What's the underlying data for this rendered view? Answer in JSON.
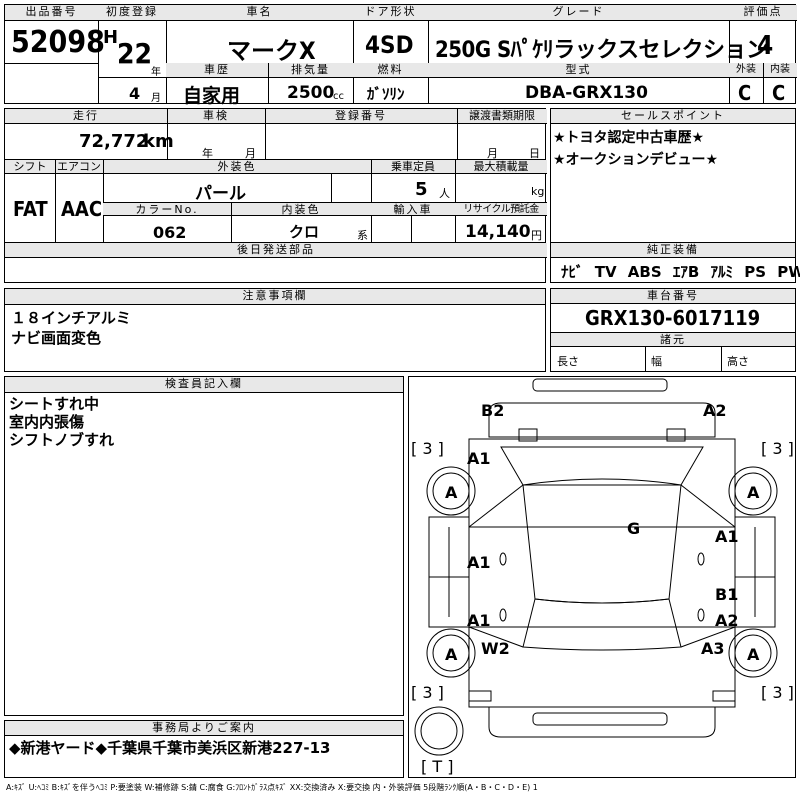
{
  "top": {
    "lot_label": "出品番号",
    "lot_number": "52098",
    "first_reg_label": "初度登録",
    "era": "H",
    "year": "22",
    "year_unit": "年",
    "month": "4",
    "month_unit": "月",
    "model_label": "車名",
    "model": "マークX",
    "door_label": "ドア形状",
    "door": "4SD",
    "grade_label": "グレード",
    "grade": "250G Sﾊﾟｹﾘラックスセレクション",
    "score_label": "評価点",
    "score": "4",
    "history_label": "車歴",
    "history": "自家用",
    "displacement_label": "排気量",
    "displacement": "2500",
    "cc": "cc",
    "fuel_label": "燃料",
    "fuel": "ｶﾞｿﾘﾝ",
    "type_label": "型式",
    "type": "DBA-GRX130",
    "ext_label": "外装",
    "ext": "C",
    "int_label": "内装",
    "int": "C"
  },
  "mid": {
    "mileage_label": "走行",
    "mileage": "72,772",
    "km": "km",
    "inspection_label": "車検",
    "insp_year": "年",
    "insp_month": "月",
    "reg_label": "登録番号",
    "doc_label": "譲渡書類期限",
    "doc_month": "月",
    "doc_day": "日",
    "shift_label": "シフト",
    "shift": "FAT",
    "ac_label": "エアコン",
    "ac": "AAC",
    "exterior_color_label": "外装色",
    "exterior_color": "パール",
    "capacity_label": "乗車定員",
    "capacity": "5",
    "capacity_unit": "人",
    "load_label": "最大積載量",
    "load_unit": "kg",
    "color_no_label": "カラーNo.",
    "color_no": "062",
    "interior_color_label": "内装色",
    "interior_color": "クロ",
    "interior_suffix": "系",
    "import_label": "輸入車",
    "recycle_label": "リサイクル預託金",
    "recycle": "14,140",
    "recycle_unit": "円",
    "later_label": "後日発送部品"
  },
  "sales": {
    "label": "セールスポイント",
    "lines": [
      "★トヨタ認定中古車歴★",
      "★オークションデビュー★"
    ]
  },
  "equipment": {
    "label": "純正装備",
    "items": "ﾅﾋﾞ TV ABS ｴｱB ｱﾙﾐ PS PW"
  },
  "caution": {
    "label": "注意事項欄",
    "lines": [
      "１８インチアルミ",
      "ナビ画面変色"
    ]
  },
  "chassis": {
    "label": "車台番号",
    "number": "GRX130-6017119",
    "spec_label": "諸元",
    "length": "長さ",
    "width": "幅",
    "height": "高さ"
  },
  "inspector": {
    "label": "検査員記入欄",
    "lines": [
      "シートすれ中",
      "室内内張傷",
      "シフトノブすれ"
    ]
  },
  "office": {
    "label": "事務局よりご案内",
    "text": "◆新港ヤード◆千葉県千葉市美浜区新港227-13"
  },
  "diagram": {
    "marks": {
      "b2": "B2",
      "a2_top": "A2",
      "a1_front": "A1",
      "tire_fl": "A",
      "tire_fr": "A",
      "tire_rl": "A",
      "tire_rr": "A",
      "g": "G",
      "a1_right": "A1",
      "a1_left_mid": "A1",
      "a1_left_low": "A1",
      "b1": "B1",
      "a2_right": "A2",
      "w2": "W2",
      "a3": "A3",
      "tread_tl": "[ 3 ]",
      "tread_tr": "[ 3 ]",
      "tread_bl": "[ 3 ]",
      "tread_br": "[ 3 ]",
      "spare": "[ T ]"
    }
  },
  "legend": "A:ｷｽﾞ U:ﾍｺﾐ B:ｷｽﾞを伴うﾍｺﾐ P:要塗装 W:補修跡 S:錆 C:腐食 G:ﾌﾛﾝﾄｶﾞﾗｽ点ｷｽﾞ XX:交換済み X:要交換  内・外装評価 5段階ﾗﾝｸ順(A・B・C・D・E) 1"
}
